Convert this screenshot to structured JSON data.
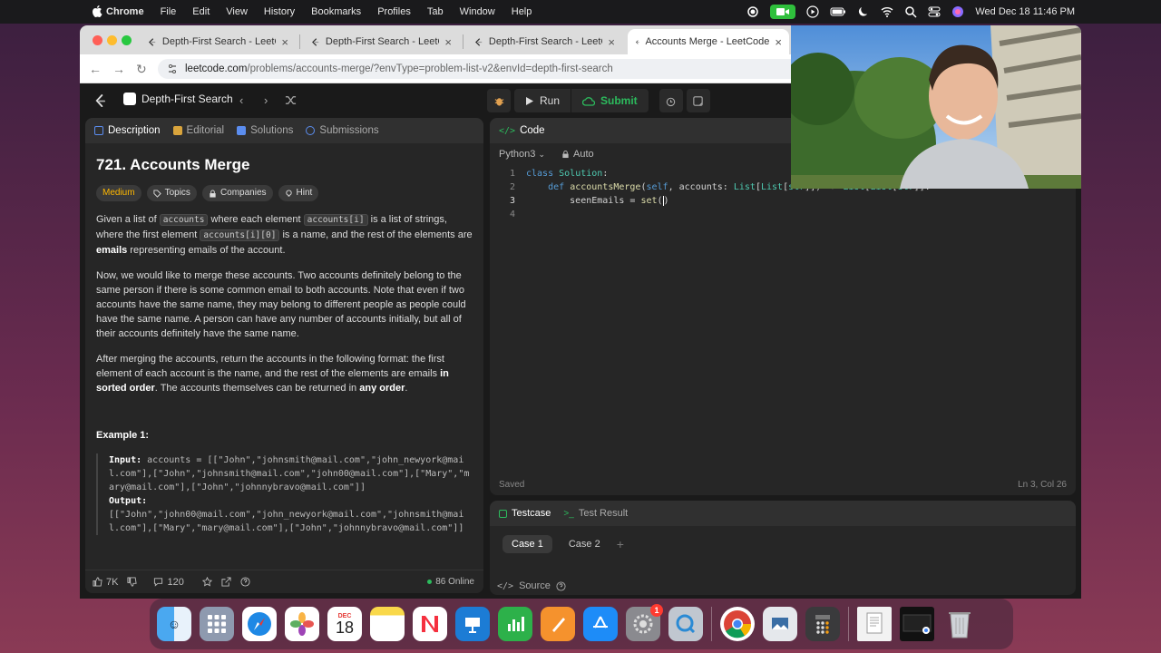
{
  "menubar": {
    "app_name": "Chrome",
    "menus": [
      "File",
      "Edit",
      "View",
      "History",
      "Bookmarks",
      "Profiles",
      "Tab",
      "Window",
      "Help"
    ],
    "clock": "Wed Dec 18  11:46 PM"
  },
  "browser": {
    "tabs": [
      {
        "title": "Depth-First Search - LeetCode"
      },
      {
        "title": "Depth-First Search - LeetCode"
      },
      {
        "title": "Depth-First Search - LeetCode"
      },
      {
        "title": "Accounts Merge - LeetCode"
      }
    ],
    "url_host": "leetcode.com",
    "url_path": "/problems/accounts-merge/?envType=problem-list-v2&envId=depth-first-search"
  },
  "lc_header": {
    "list_title": "Depth-First Search",
    "run_label": "Run",
    "submit_label": "Submit"
  },
  "left_panel": {
    "tabs": [
      "Description",
      "Editorial",
      "Solutions",
      "Submissions"
    ],
    "title": "721. Accounts Merge",
    "difficulty": "Medium",
    "chips": [
      "Topics",
      "Companies",
      "Hint"
    ],
    "p1": {
      "a": "Given a list of ",
      "code1": "accounts",
      "b": " where each element ",
      "code2": "accounts[i]",
      "c": " is a list of strings, where the first element ",
      "code3": "accounts[i][0]",
      "d": " is a name, and the rest of the elements are ",
      "bold": "emails",
      "e": " representing emails of the account."
    },
    "p2": "Now, we would like to merge these accounts. Two accounts definitely belong to the same person if there is some common email to both accounts. Note that even if two accounts have the same name, they may belong to different people as people could have the same name. A person can have any number of accounts initially, but all of their accounts definitely have the same name.",
    "p3": {
      "a": "After merging the accounts, return the accounts in the following format: the first element of each account is the name, and the rest of the elements are emails ",
      "bold1": "in sorted order",
      "b": ". The accounts themselves can be returned in ",
      "bold2": "any order",
      "c": "."
    },
    "example_title": "Example 1:",
    "input_label": "Input:",
    "input_text": "accounts = [[\"John\",\"johnsmith@mail.com\",\"john_newyork@mail.com\"],[\"John\",\"johnsmith@mail.com\",\"john00@mail.com\"],[\"Mary\",\"mary@mail.com\"],[\"John\",\"johnnybravo@mail.com\"]]",
    "output_label": "Output:",
    "output_text": "[[\"John\",\"john00@mail.com\",\"john_newyork@mail.com\",\"johnsmith@mail.com\"],[\"Mary\",\"mary@mail.com\"],[\"John\",\"johnnybravo@mail.com\"]]",
    "likes": "7K",
    "comments": "120",
    "online": "86 Online"
  },
  "code_panel": {
    "title": "Code",
    "language": "Python3",
    "mode": "Auto",
    "lines": [
      {
        "num": "1"
      },
      {
        "num": "2"
      },
      {
        "num": "3"
      },
      {
        "num": "4"
      }
    ],
    "status": "Saved",
    "cursor": "Ln 3, Col 26"
  },
  "test_panel": {
    "tab_testcase": "Testcase",
    "tab_result": "Test Result",
    "cases": [
      "Case 1",
      "Case 2"
    ],
    "source": "Source"
  },
  "dock": {
    "calendar_month": "DEC",
    "calendar_day": "18",
    "badge_count": "1"
  }
}
